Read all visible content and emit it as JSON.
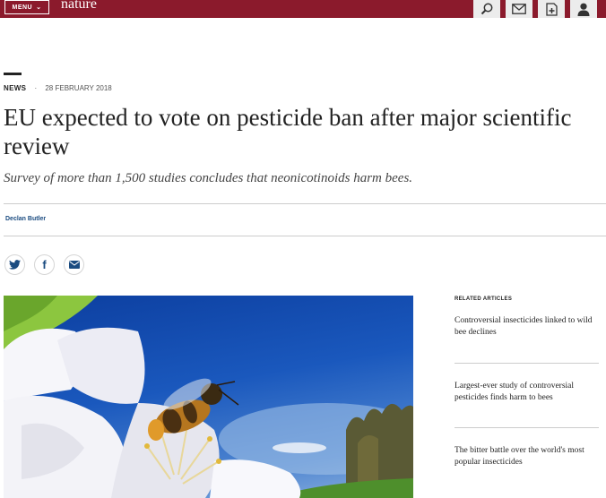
{
  "header": {
    "menu_label": "MENU",
    "logo_text": "nature",
    "brand_color": "#8b1a2c",
    "icons": [
      "search-icon",
      "mail-icon",
      "subscribe-icon",
      "user-icon"
    ]
  },
  "article": {
    "type": "NEWS",
    "date": "28 FEBRUARY 2018",
    "title": "EU expected to vote on pesticide ban after major scientific review",
    "standfirst": "Survey of more than 1,500 studies concludes that neonicotinoids harm bees.",
    "author": "Declan Butler",
    "share": [
      "twitter-icon",
      "facebook-icon",
      "email-icon"
    ]
  },
  "related": {
    "heading": "RELATED ARTICLES",
    "items": [
      {
        "title": "Controversial insecticides linked to wild bee declines"
      },
      {
        "title": "Largest-ever study of controversial pesticides finds harm to bees"
      },
      {
        "title": "The bitter battle over the world's most popular insecticides"
      }
    ]
  }
}
